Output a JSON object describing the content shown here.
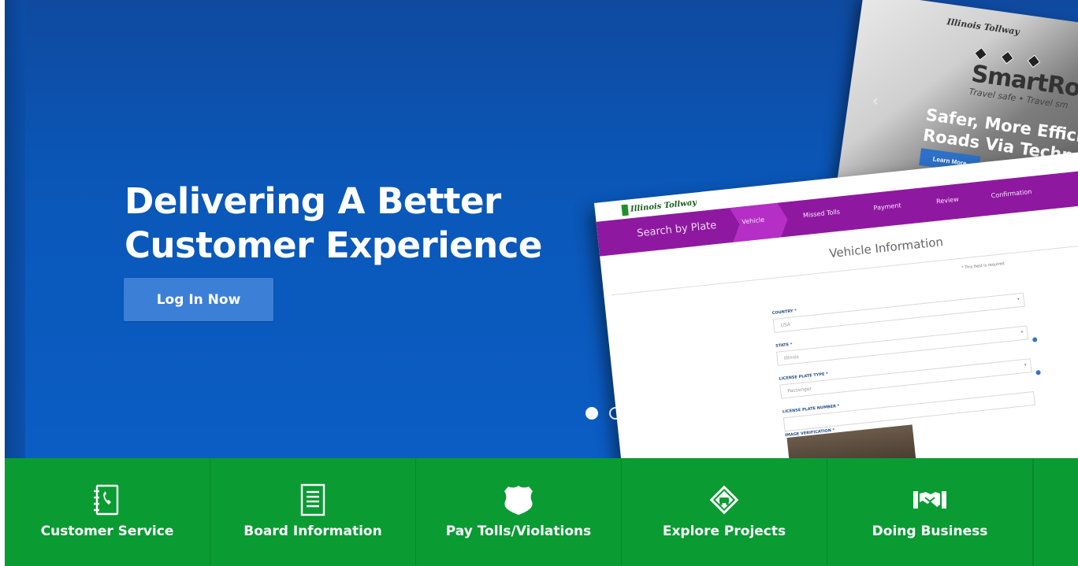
{
  "hero": {
    "title_line1": "Delivering A Better",
    "title_line2": "Customer Experience",
    "login_label": "Log In Now",
    "carousel": {
      "slides": 4,
      "active": 1
    }
  },
  "back_shot": {
    "brand": "Illinois Tollway",
    "product": "SmartRo",
    "tagline": "Travel safe • Travel sm",
    "headline_line1": "Safer, More Effici",
    "headline_line2": "Roads Via Techno",
    "button": "Learn More"
  },
  "front_shot": {
    "brand": "Illinois Tollway",
    "nav_title": "Search by Plate",
    "steps": [
      "Vehicle",
      "Missed Tolls",
      "Payment",
      "Review",
      "Confirmation"
    ],
    "page_title": "Vehicle Information",
    "required_note": "* This field is required",
    "fields": [
      {
        "label": "COUNTRY *",
        "value": "USA"
      },
      {
        "label": "STATE *",
        "value": "Illinois"
      },
      {
        "label": "LICENSE PLATE TYPE *",
        "value": "Passenger"
      },
      {
        "label": "LICENSE PLATE NUMBER *",
        "value": ""
      }
    ],
    "image_label": "IMAGE VERIFICATION *"
  },
  "tiles": [
    {
      "label": "Customer Service",
      "icon": "phone-book-icon"
    },
    {
      "label": "Board Information",
      "icon": "document-icon"
    },
    {
      "label": "Pay Tolls/Violations",
      "icon": "shield-icon"
    },
    {
      "label": "Explore Projects",
      "icon": "road-sign-icon"
    },
    {
      "label": "Doing Business",
      "icon": "handshake-icon"
    }
  ],
  "colors": {
    "hero_blue": "#0b5dc4",
    "button_blue": "#3c7fd6",
    "tile_green": "#0a9b32",
    "nav_purple": "#8e19a0"
  }
}
